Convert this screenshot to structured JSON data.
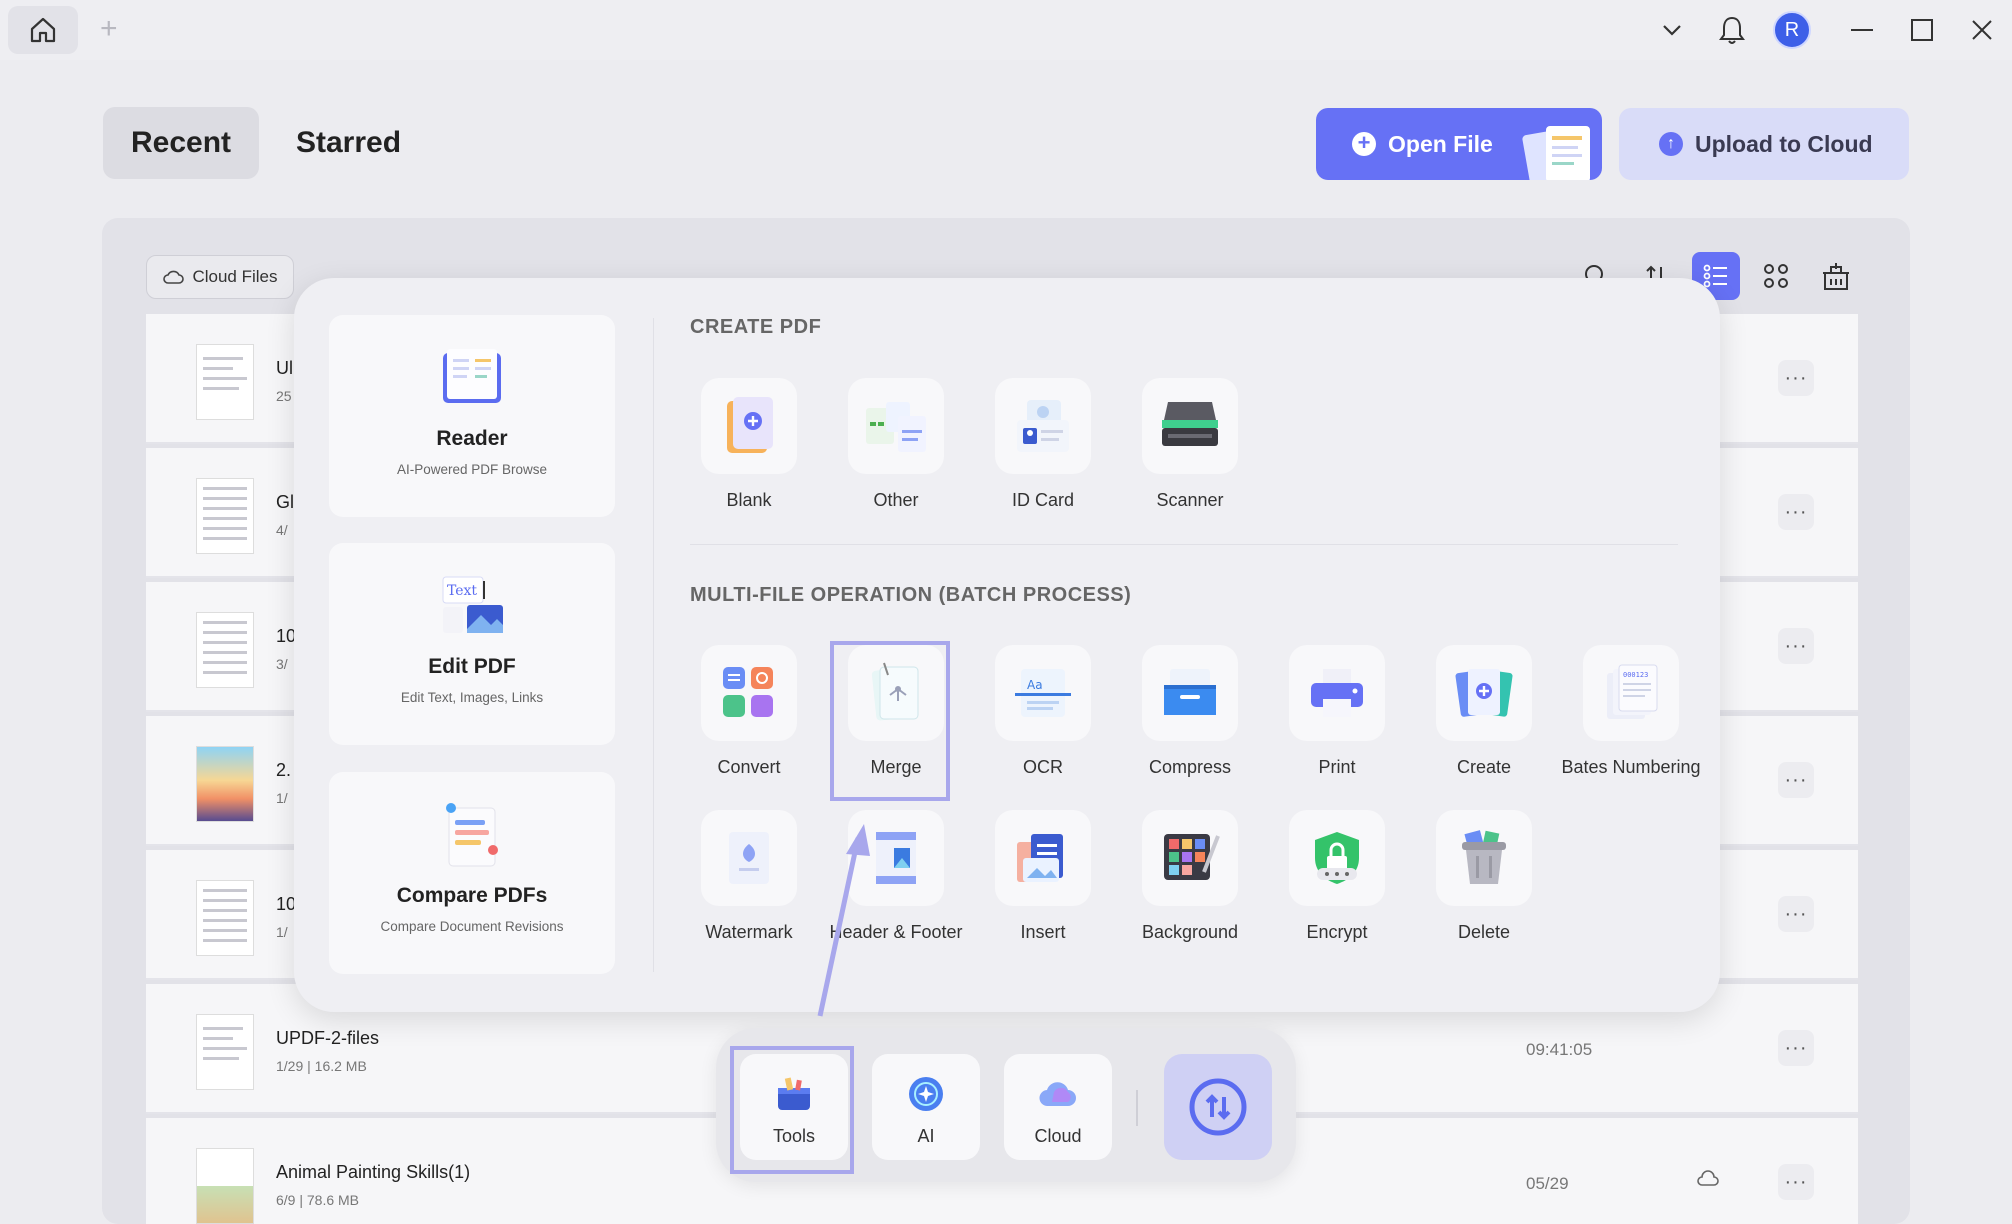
{
  "titlebar": {
    "avatar_letter": "R"
  },
  "tabs": {
    "recent": "Recent",
    "starred": "Starred"
  },
  "actions": {
    "open_file": "Open File",
    "upload_to_cloud": "Upload to Cloud"
  },
  "files_panel": {
    "cloud_files": "Cloud Files",
    "rows": [
      {
        "name": "Ul",
        "meta": "25",
        "date": "",
        "cloud": true
      },
      {
        "name": "Gl",
        "meta": "4/",
        "date": "",
        "cloud": true
      },
      {
        "name": "10",
        "meta": "3/",
        "date": "",
        "cloud": true
      },
      {
        "name": "2.",
        "meta": "1/",
        "date": "",
        "cloud": true
      },
      {
        "name": "10",
        "meta": "1/",
        "date": "",
        "cloud": true
      },
      {
        "name": "UPDF-2-files",
        "meta": "1/29 | 16.2 MB",
        "date": "09:41:05",
        "cloud": false
      },
      {
        "name": "Animal Painting Skills(1)",
        "meta": "6/9 | 78.6 MB",
        "date": "05/29",
        "cloud": true
      }
    ]
  },
  "popup": {
    "left_cards": [
      {
        "title": "Reader",
        "subtitle": "AI-Powered PDF Browse",
        "icon": "reader-icon"
      },
      {
        "title": "Edit PDF",
        "subtitle": "Edit Text, Images, Links",
        "icon": "edit-pdf-icon"
      },
      {
        "title": "Compare PDFs",
        "subtitle": "Compare Document Revisions",
        "icon": "compare-pdfs-icon"
      }
    ],
    "create_title": "CREATE PDF",
    "create_items": [
      {
        "label": "Blank",
        "icon": "blank-icon"
      },
      {
        "label": "Other",
        "icon": "other-icon"
      },
      {
        "label": "ID Card",
        "icon": "id-card-icon"
      },
      {
        "label": "Scanner",
        "icon": "scanner-icon"
      }
    ],
    "batch_title": "MULTI-FILE OPERATION (BATCH PROCESS)",
    "batch_items": [
      {
        "label": "Convert",
        "icon": "convert-icon"
      },
      {
        "label": "Merge",
        "icon": "merge-icon"
      },
      {
        "label": "OCR",
        "icon": "ocr-icon"
      },
      {
        "label": "Compress",
        "icon": "compress-icon"
      },
      {
        "label": "Print",
        "icon": "print-icon"
      },
      {
        "label": "Create",
        "icon": "create-icon"
      },
      {
        "label": "Bates Numbering",
        "icon": "bates-numbering-icon"
      },
      {
        "label": "Watermark",
        "icon": "watermark-icon"
      },
      {
        "label": "Header & Footer",
        "icon": "header-footer-icon"
      },
      {
        "label": "Insert",
        "icon": "insert-icon"
      },
      {
        "label": "Background",
        "icon": "background-icon"
      },
      {
        "label": "Encrypt",
        "icon": "encrypt-icon"
      },
      {
        "label": "Delete",
        "icon": "delete-icon"
      }
    ]
  },
  "dock": {
    "tools": "Tools",
    "ai": "AI",
    "cloud": "Cloud"
  },
  "colors": {
    "accent": "#6671f5",
    "highlight": "#a8a7ec",
    "background": "#ececf0"
  }
}
